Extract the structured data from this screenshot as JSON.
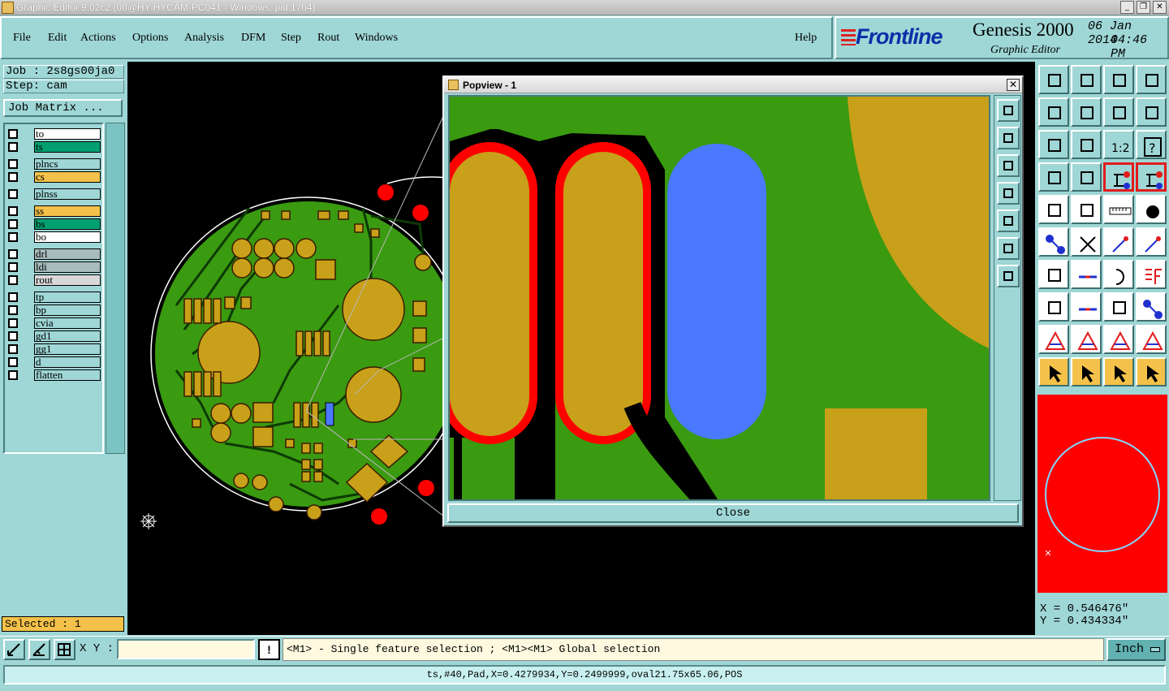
{
  "window": {
    "title": "Graphic Editor 9.02c2 (00@HY-HYCAM-PC041 - Windows, pid:1704)"
  },
  "menu": {
    "items": [
      "File",
      "Edit",
      "Actions",
      "Options",
      "Analysis",
      "DFM",
      "Step",
      "Rout",
      "Windows"
    ],
    "help": "Help"
  },
  "brand": {
    "logo": "Frontline",
    "product": "Genesis 2000",
    "subtitle": "Graphic Editor",
    "date": "06 Jan 2014",
    "time": "04:46 PM"
  },
  "job": {
    "job_label": "Job : 2s8gs00ja0",
    "step_label": "Step: cam",
    "matrix_button": "Job Matrix ..."
  },
  "layers": [
    {
      "name": "to",
      "color": "#ffffff"
    },
    {
      "name": "ts",
      "color": "#00a070"
    },
    {
      "name": "plncs",
      "color": "#9fd6d6"
    },
    {
      "name": "cs",
      "color": "#f4c24a"
    },
    {
      "name": "plnss",
      "color": "#9fd6d6"
    },
    {
      "name": "ss",
      "color": "#f4c24a"
    },
    {
      "name": "bs",
      "color": "#00a070"
    },
    {
      "name": "bo",
      "color": "#ffffff"
    },
    {
      "name": "drl",
      "color": "#a8bcbc"
    },
    {
      "name": "ldi",
      "color": "#a8bcbc"
    },
    {
      "name": "rout",
      "color": "#d8d8d8"
    },
    {
      "name": "tp",
      "color": "#9fd6d6"
    },
    {
      "name": "bp",
      "color": "#9fd6d6"
    },
    {
      "name": "cvia",
      "color": "#9fd6d6"
    },
    {
      "name": "gd1",
      "color": "#9fd6d6"
    },
    {
      "name": "gg1",
      "color": "#9fd6d6"
    },
    {
      "name": "d",
      "color": "#9fd6d6"
    },
    {
      "name": "flatten",
      "color": "#9fd6d6"
    }
  ],
  "selection": {
    "label": "Selected : 1"
  },
  "popview": {
    "title": "Popview - 1",
    "close_button": "Close"
  },
  "coords": {
    "x": "X = 0.546476\"",
    "y": "Y = 0.434334\""
  },
  "command": {
    "xy_label": "X Y :",
    "xy_value": "",
    "warn": "!",
    "hint": "<M1> - Single feature selection ; <M1><M1> Global selection",
    "units": "Inch"
  },
  "status": {
    "text": "ts,#40,Pad,X=0.4279934,Y=0.2499999,oval21.75x65.06,POS"
  },
  "colors": {
    "board_green": "#3a9a10",
    "copper": "#c9a019",
    "selected_red": "#ff0000",
    "highlight_blue": "#4a78ff",
    "accent_panel": "#9fd6d6"
  }
}
